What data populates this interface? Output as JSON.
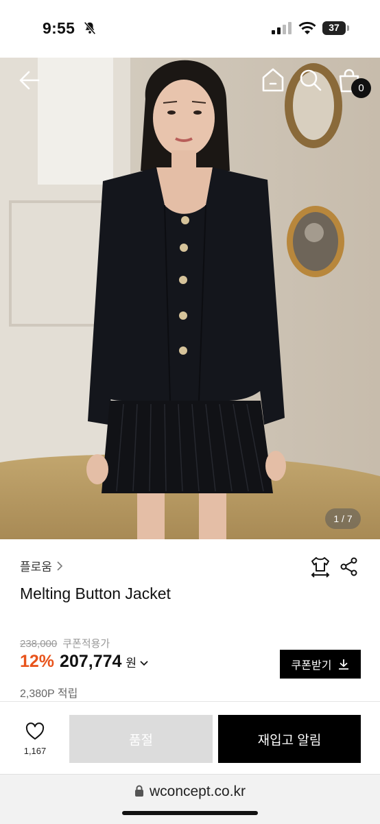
{
  "status_bar": {
    "time": "9:55",
    "battery": "37"
  },
  "hero": {
    "image_counter": "1 / 7"
  },
  "header": {
    "cart_count": "0"
  },
  "product": {
    "brand": "플로움",
    "title": "Melting Button Jacket",
    "original_price": "238,000",
    "coupon_label": "쿠폰적용가",
    "discount": "12%",
    "price": "207,774",
    "currency": "원",
    "coupon_button": "쿠폰받기",
    "points": "2,380P 적립"
  },
  "bottom_bar": {
    "wish_count": "1,167",
    "soldout_label": "품절",
    "restock_label": "재입고 알림"
  },
  "browser": {
    "url": "wconcept.co.kr"
  },
  "colors": {
    "discount": "#e8541c",
    "primary_button": "#000000",
    "disabled_button": "#dcdcdc"
  },
  "icons": [
    "back-arrow-icon",
    "home-icon",
    "search-icon",
    "shopping-bag-icon",
    "size-guide-icon",
    "share-icon",
    "heart-icon",
    "download-icon",
    "lock-icon",
    "bell-off-icon",
    "signal-icon",
    "wifi-icon",
    "battery-icon"
  ]
}
